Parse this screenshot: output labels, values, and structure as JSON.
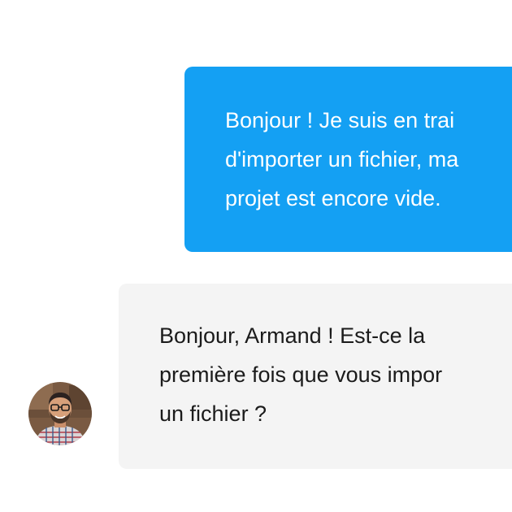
{
  "conversation": {
    "messages": [
      {
        "sender": "user",
        "lines": [
          "Bonjour ! Je suis en trai",
          "d'importer un fichier, ma",
          "projet est encore vide."
        ]
      },
      {
        "sender": "agent",
        "lines": [
          "Bonjour, Armand ! Est-ce la",
          "première fois que vous impor",
          "un fichier ?"
        ]
      }
    ]
  },
  "colors": {
    "outgoing_bubble": "#14a0f3",
    "incoming_bubble": "#f4f4f4",
    "outgoing_text": "#ffffff",
    "incoming_text": "#1b1b1b"
  },
  "icons": {
    "agent_avatar": "agent-avatar-photo"
  }
}
